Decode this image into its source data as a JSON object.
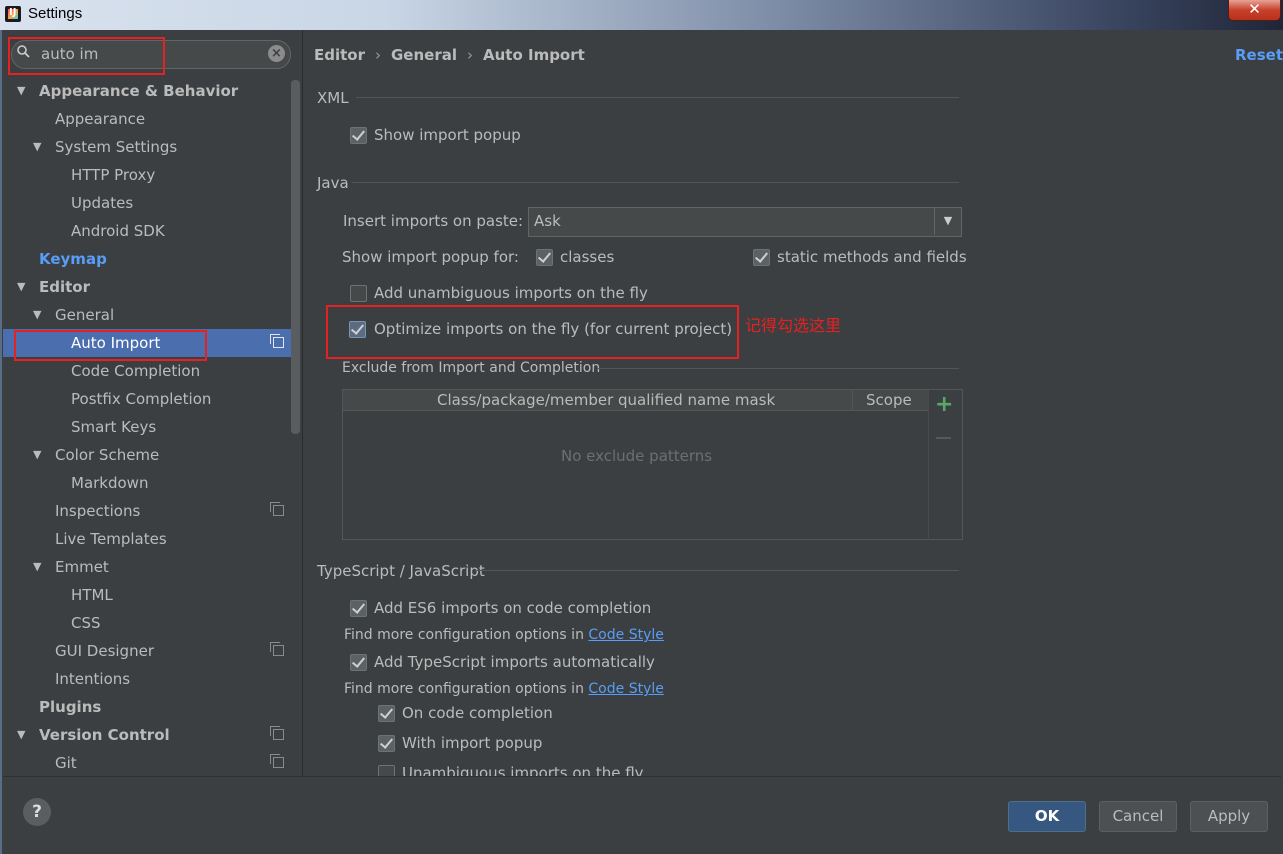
{
  "window": {
    "title": "Settings",
    "close_glyph": "✕"
  },
  "search": {
    "value": "auto im",
    "clear_glyph": "×"
  },
  "tree": [
    {
      "label": "Appearance & Behavior",
      "bold": true,
      "expanded": true
    },
    {
      "label": "Appearance"
    },
    {
      "label": "System Settings",
      "expanded": true
    },
    {
      "label": "HTTP Proxy"
    },
    {
      "label": "Updates"
    },
    {
      "label": "Android SDK"
    },
    {
      "label": "Keymap",
      "color": "#589df6",
      "bold": true
    },
    {
      "label": "Editor",
      "bold": true,
      "expanded": true
    },
    {
      "label": "General",
      "expanded": true
    },
    {
      "label": "Auto Import",
      "selected": true,
      "project_icon": "copy-icon"
    },
    {
      "label": "Code Completion"
    },
    {
      "label": "Postfix Completion"
    },
    {
      "label": "Smart Keys"
    },
    {
      "label": "Color Scheme",
      "expanded": true
    },
    {
      "label": "Markdown"
    },
    {
      "label": "Inspections",
      "project_icon": "copy-icon"
    },
    {
      "label": "Live Templates"
    },
    {
      "label": "Emmet",
      "expanded": true
    },
    {
      "label": "HTML"
    },
    {
      "label": "CSS"
    },
    {
      "label": "GUI Designer",
      "project_icon": "copy-icon"
    },
    {
      "label": "Intentions"
    },
    {
      "label": "Plugins",
      "bold": true
    },
    {
      "label": "Version Control",
      "bold": true,
      "expanded": true,
      "project_icon": "copy-icon"
    },
    {
      "label": "Git",
      "project_icon": "copy-icon"
    }
  ],
  "breadcrumb": {
    "items": [
      "Editor",
      "General",
      "Auto Import"
    ],
    "separator": "›"
  },
  "reset_label": "Reset",
  "annotation": {
    "note": "记得勾选这里",
    "color": "#e52121"
  },
  "xml": {
    "title": "XML",
    "show_import_popup": {
      "label": "Show import popup",
      "checked": true
    }
  },
  "java": {
    "title": "Java",
    "insert_on_paste_label": "Insert imports on paste:",
    "insert_on_paste_value": "Ask",
    "show_popup_for_label": "Show import popup for:",
    "classes": {
      "label": "classes",
      "checked": true
    },
    "static_methods": {
      "label": "static methods and fields",
      "checked": true
    },
    "add_unambiguous": {
      "label": "Add unambiguous imports on the fly",
      "checked": false
    },
    "optimize_imports": {
      "label": "Optimize imports on the fly (for current project)",
      "checked": true
    },
    "exclude_title": "Exclude from Import and Completion",
    "exclude_columns": [
      "Class/package/member qualified name mask",
      "Scope"
    ],
    "exclude_empty": "No exclude patterns",
    "add_glyph": "+"
  },
  "ts": {
    "title": "TypeScript / JavaScript",
    "es6": {
      "label": "Add ES6 imports on code completion",
      "checked": true
    },
    "find_more_1": "Find more configuration options in",
    "code_style_link_1": "Code Style",
    "ts_auto": {
      "label": "Add TypeScript imports automatically",
      "checked": true
    },
    "find_more_2": "Find more configuration options in",
    "code_style_link_2": "Code Style",
    "on_code_completion": {
      "label": "On code completion",
      "checked": true
    },
    "with_import_popup": {
      "label": "With import popup",
      "checked": true
    },
    "unambiguous": {
      "label": "Unambiguous imports on the fly",
      "checked": false
    }
  },
  "buttons": {
    "help": "?",
    "ok": "OK",
    "cancel": "Cancel",
    "apply": "Apply"
  }
}
